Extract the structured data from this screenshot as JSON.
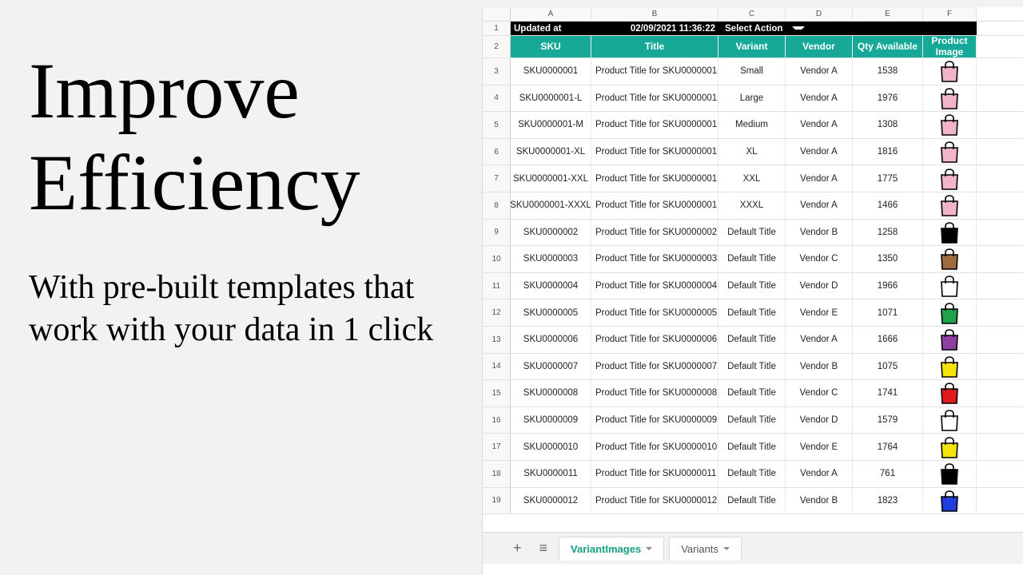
{
  "headline": "Improve Efficiency",
  "subhead": "With pre-built templates that work with your data in 1 click",
  "column_letters": [
    "",
    "A",
    "B",
    "C",
    "D",
    "E",
    "F"
  ],
  "action_bar": {
    "updated_label": "Updated at",
    "timestamp": "02/09/2021 11:36:22",
    "select_action": "Select Action"
  },
  "headers": {
    "sku": "SKU",
    "title": "Title",
    "variant": "Variant",
    "vendor": "Vendor",
    "qty": "Qty Available",
    "image": "Product Image"
  },
  "rows": [
    {
      "n": "3",
      "sku": "SKU0000001",
      "title": "Product Title for SKU0000001",
      "variant": "Small",
      "vendor": "Vendor A",
      "qty": "1538",
      "bag": "#f4b4c8"
    },
    {
      "n": "4",
      "sku": "SKU0000001-L",
      "title": "Product Title for SKU0000001",
      "variant": "Large",
      "vendor": "Vendor A",
      "qty": "1976",
      "bag": "#f4b4c8"
    },
    {
      "n": "5",
      "sku": "SKU0000001-M",
      "title": "Product Title for SKU0000001",
      "variant": "Medium",
      "vendor": "Vendor A",
      "qty": "1308",
      "bag": "#f4b4c8"
    },
    {
      "n": "6",
      "sku": "SKU0000001-XL",
      "title": "Product Title for SKU0000001",
      "variant": "XL",
      "vendor": "Vendor A",
      "qty": "1816",
      "bag": "#f4b4c8"
    },
    {
      "n": "7",
      "sku": "SKU0000001-XXL",
      "title": "Product Title for SKU0000001",
      "variant": "XXL",
      "vendor": "Vendor A",
      "qty": "1775",
      "bag": "#f4b4c8"
    },
    {
      "n": "8",
      "sku": "SKU0000001-XXXL",
      "title": "Product Title for SKU0000001",
      "variant": "XXXL",
      "vendor": "Vendor A",
      "qty": "1466",
      "bag": "#f4b4c8"
    },
    {
      "n": "9",
      "sku": "SKU0000002",
      "title": "Product Title for SKU0000002",
      "variant": "Default Title",
      "vendor": "Vendor B",
      "qty": "1258",
      "bag": "#000000"
    },
    {
      "n": "10",
      "sku": "SKU0000003",
      "title": "Product Title for SKU0000003",
      "variant": "Default Title",
      "vendor": "Vendor C",
      "qty": "1350",
      "bag": "#a06b3f"
    },
    {
      "n": "11",
      "sku": "SKU0000004",
      "title": "Product Title for SKU0000004",
      "variant": "Default Title",
      "vendor": "Vendor D",
      "qty": "1966",
      "bag": "#ffffff"
    },
    {
      "n": "12",
      "sku": "SKU0000005",
      "title": "Product Title for SKU0000005",
      "variant": "Default Title",
      "vendor": "Vendor E",
      "qty": "1071",
      "bag": "#1fa24a"
    },
    {
      "n": "13",
      "sku": "SKU0000006",
      "title": "Product Title for SKU0000006",
      "variant": "Default Title",
      "vendor": "Vendor A",
      "qty": "1666",
      "bag": "#8e3fa0"
    },
    {
      "n": "14",
      "sku": "SKU0000007",
      "title": "Product Title for SKU0000007",
      "variant": "Default Title",
      "vendor": "Vendor B",
      "qty": "1075",
      "bag": "#f4e20a"
    },
    {
      "n": "15",
      "sku": "SKU0000008",
      "title": "Product Title for SKU0000008",
      "variant": "Default Title",
      "vendor": "Vendor C",
      "qty": "1741",
      "bag": "#e11b1b"
    },
    {
      "n": "16",
      "sku": "SKU0000009",
      "title": "Product Title for SKU0000009",
      "variant": "Default Title",
      "vendor": "Vendor D",
      "qty": "1579",
      "bag": "#ffffff"
    },
    {
      "n": "17",
      "sku": "SKU0000010",
      "title": "Product Title for SKU0000010",
      "variant": "Default Title",
      "vendor": "Vendor E",
      "qty": "1764",
      "bag": "#f4e20a"
    },
    {
      "n": "18",
      "sku": "SKU0000011",
      "title": "Product Title for SKU0000011",
      "variant": "Default Title",
      "vendor": "Vendor A",
      "qty": "761",
      "bag": "#000000"
    },
    {
      "n": "19",
      "sku": "SKU0000012",
      "title": "Product Title for SKU0000012",
      "variant": "Default Title",
      "vendor": "Vendor B",
      "qty": "1823",
      "bag": "#1f3fe1"
    }
  ],
  "tabs": {
    "add": "+",
    "menu": "≡",
    "active": "VariantImages",
    "other": "Variants"
  }
}
